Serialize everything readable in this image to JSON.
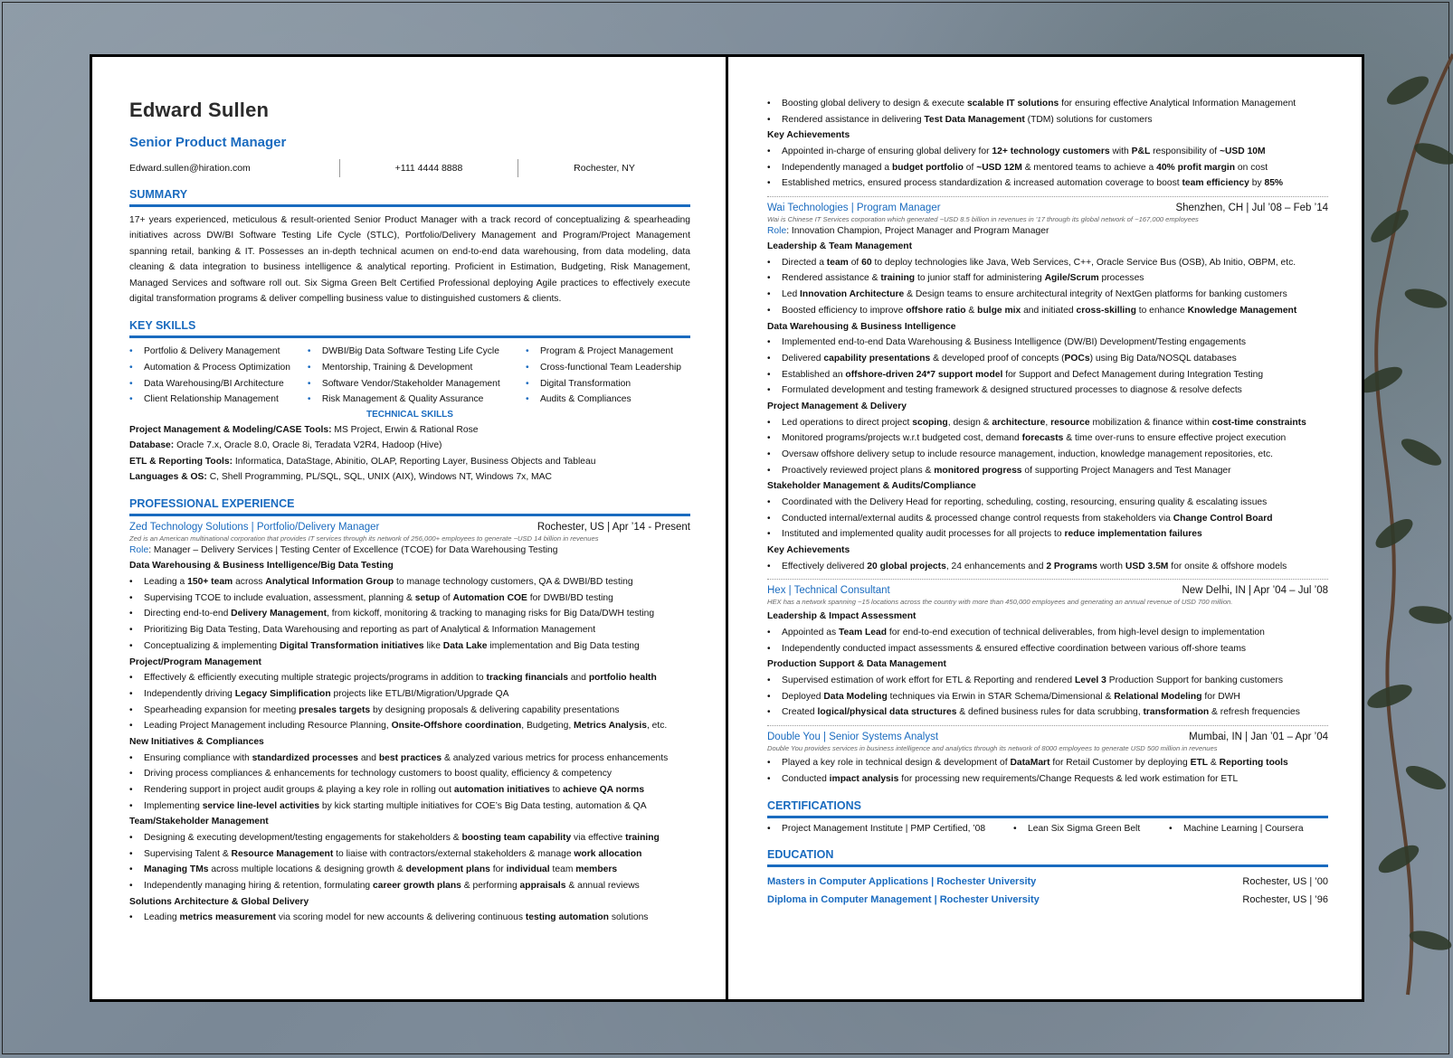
{
  "resume": {
    "name": "Edward Sullen",
    "title": "Senior Product Manager",
    "contact": {
      "email": "Edward.sullen@hiration.com",
      "phone": "+111 4444 8888",
      "location": "Rochester, NY"
    },
    "summary": {
      "heading": "SUMMARY",
      "text": "17+ years experienced, meticulous & result-oriented Senior Product Manager with a track record of conceptualizing & spearheading initiatives across DW/BI Software Testing Life Cycle (STLC), Portfolio/Delivery Management and Program/Project Management spanning retail, banking & IT. Possesses an in-depth technical acumen on end-to-end data warehousing, from data modeling, data cleaning & data integration to business intelligence & analytical reporting. Proficient in Estimation, Budgeting, Risk Management, Managed Services and software roll out. Six Sigma Green Belt Certified Professional deploying Agile practices to effectively execute digital transformation programs & deliver compelling business value to distinguished customers & clients."
    },
    "key_skills": {
      "heading": "KEY SKILLS",
      "col1": [
        "Portfolio & Delivery Management",
        "Automation & Process Optimization",
        "Data Warehousing/BI Architecture",
        "Client Relationship Management"
      ],
      "col2": [
        "DWBI/Big Data Software Testing Life Cycle",
        "Mentorship, Training & Development",
        "Software Vendor/Stakeholder Management",
        "Risk Management & Quality Assurance"
      ],
      "col3": [
        "Program & Project Management",
        "Cross-functional Team Leadership",
        "Digital Transformation",
        "Audits & Compliances"
      ]
    },
    "technical_skills": {
      "heading": "TECHNICAL SKILLS",
      "lines": [
        {
          "label": "Project Management & Modeling/CASE Tools:",
          "value": " MS Project, Erwin & Rational Rose"
        },
        {
          "label": "Database:",
          "value": " Oracle 7.x, Oracle 8.0, Oracle 8i, Teradata V2R4, Hadoop (Hive)"
        },
        {
          "label": "ETL & Reporting Tools:",
          "value": " Informatica, DataStage, Abinitio, OLAP, Reporting Layer, Business Objects and Tableau"
        },
        {
          "label": "Languages & OS:",
          "value": " C, Shell Programming, PL/SQL, SQL, UNIX (AIX), Windows NT, Windows 7x, MAC"
        }
      ]
    },
    "experience": {
      "heading": "PROFESSIONAL EXPERIENCE",
      "zed": {
        "company": "Zed Technology Solutions | Portfolio/Delivery Manager",
        "meta": "Rochester, US | Apr ’14 - Present",
        "desc": "Zed is an American multinational corporation that provides IT services through its network of 256,000+ employees to generate ~USD 14 billion in revenues",
        "role_label": "Role",
        "role": ": Manager – Delivery Services | Testing Center of Excellence (TCOE) for Data Warehousing Testing",
        "groups": [
          {
            "title": "Data Warehousing & Business Intelligence/Big Data Testing",
            "bullets": [
              "Leading a <b>150+ team</b> across <b>Analytical Information Group</b> to manage technology customers, QA & DWBI/BD testing",
              "Supervising TCOE to include evaluation, assessment, planning & <b>setup</b> of <b>Automation COE</b> for DWBI/BD testing",
              "Directing end-to-end <b>Delivery Management</b>, from kickoff, monitoring & tracking to managing risks for Big Data/DWH testing",
              "Prioritizing Big Data Testing, Data Warehousing and reporting as part of Analytical & Information Management",
              "Conceptualizing & implementing <b>Digital Transformation initiatives</b> like <b>Data Lake</b> implementation and Big Data testing"
            ]
          },
          {
            "title": "Project/Program Management",
            "bullets": [
              "Effectively & efficiently executing multiple strategic projects/programs in addition to <b>tracking financials</b> and <b>portfolio health</b>",
              "Independently driving <b>Legacy Simplification</b> projects like ETL/BI/Migration/Upgrade QA",
              "Spearheading expansion for meeting <b>presales targets</b> by designing proposals & delivering capability presentations",
              "Leading Project Management including Resource Planning, <b>Onsite-Offshore coordination</b>, Budgeting, <b>Metrics Analysis</b>, etc."
            ]
          },
          {
            "title": "New Initiatives & Compliances",
            "bullets": [
              "Ensuring compliance with <b>standardized processes</b> and <b>best practices</b> & analyzed various metrics for process enhancements",
              "Driving process compliances & enhancements for technology customers to boost quality, efficiency & competency",
              "Rendering support in project audit groups & playing a key role in rolling out <b>automation initiatives</b> to <b>achieve QA norms</b>",
              "Implementing <b>service line-level activities</b> by kick starting multiple initiatives for COE’s Big Data testing, automation & QA"
            ]
          },
          {
            "title": "Team/Stakeholder Management",
            "bullets": [
              "Designing & executing development/testing engagements for stakeholders & <b>boosting team capability</b> via effective <b>training</b>",
              "Supervising Talent & <b>Resource Management</b> to liaise with contractors/external stakeholders & manage <b>work allocation</b>",
              "<b>Managing TMs</b> across multiple locations & designing growth & <b>development plans</b> for <b>individual</b> team <b>members</b>",
              "Independently managing hiring & retention, formulating <b>career growth plans</b> & performing <b>appraisals</b> & annual reviews"
            ]
          },
          {
            "title": "Solutions Architecture & Global Delivery",
            "bullets": [
              "Leading <b>metrics measurement</b> via scoring model for new accounts & delivering continuous <b>testing automation</b> solutions"
            ]
          }
        ],
        "continued_bullets": [
          "Boosting global delivery to design & execute <b>scalable IT solutions</b> for ensuring effective Analytical Information Management",
          "Rendered assistance in delivering <b>Test Data Management</b> (TDM) solutions for customers"
        ],
        "achievements_title": "Key Achievements",
        "achievements": [
          "Appointed in-charge of ensuring global delivery for <b>12+ technology customers</b> with <b>P&L</b> responsibility of <b>~USD 10M</b>",
          "Independently managed a <b>budget portfolio</b> of <b>~USD 12M</b> & mentored teams to achieve a <b>40% profit margin</b> on cost",
          "Established metrics, ensured process standardization & increased automation coverage to boost <b>team efficiency</b> by <b>85%</b>"
        ]
      },
      "wai": {
        "company": "Wai Technologies | Program Manager",
        "meta": "Shenzhen, CH | Jul ’08 – Feb ’14",
        "desc": "Wai is Chinese IT Services corporation which generated ~USD 8.5 billion in revenues in ’17 through its global network of ~167,000 employees",
        "role_label": "Role",
        "role": ": Innovation Champion, Project Manager and Program Manager",
        "groups": [
          {
            "title": "Leadership & Team Management",
            "bullets": [
              "Directed a <b>team</b> of <b>60</b> to deploy technologies like Java, Web Services, C++, Oracle Service Bus (OSB), Ab Initio, OBPM, etc.",
              "Rendered assistance & <b>training</b> to junior staff for administering <b>Agile/Scrum</b> processes",
              "Led <b>Innovation Architecture</b> & Design teams to ensure architectural integrity of NextGen platforms for banking customers",
              "Boosted efficiency to improve <b>offshore ratio</b> & <b>bulge mix</b> and initiated <b>cross-skilling</b> to enhance <b>Knowledge Management</b>"
            ]
          },
          {
            "title": "Data Warehousing & Business Intelligence",
            "bullets": [
              "Implemented end-to-end Data Warehousing & Business Intelligence (DW/BI) Development/Testing engagements",
              "Delivered <b>capability presentations</b> & developed proof of concepts (<b>POCs</b>) using Big Data/NOSQL databases",
              "Established an <b>offshore-driven 24*7 support model</b> for Support and Defect Management during Integration Testing",
              "Formulated development and testing framework & designed structured processes to diagnose & resolve defects"
            ]
          },
          {
            "title": "Project Management & Delivery",
            "bullets": [
              "Led operations to direct project <b>scoping</b>, design & <b>architecture</b>, <b>resource</b> mobilization & finance within <b>cost-time constraints</b>",
              "Monitored programs/projects w.r.t budgeted cost, demand <b>forecasts</b> & time over-runs to ensure effective project execution",
              "Oversaw offshore delivery setup to include resource management, induction, knowledge management repositories, etc.",
              "Proactively reviewed project plans & <b>monitored progress</b> of supporting Project Managers and Test Manager"
            ]
          },
          {
            "title": "Stakeholder Management & Audits/Compliance",
            "bullets": [
              "Coordinated with the Delivery Head for reporting, scheduling, costing, resourcing, ensuring quality & escalating issues",
              "Conducted internal/external audits & processed change control requests from stakeholders via <b>Change Control Board</b>",
              "Instituted and implemented quality audit processes for all projects to <b>reduce implementation failures</b>"
            ]
          },
          {
            "title": "Key Achievements",
            "bullets": [
              "Effectively delivered <b>20 global projects</b>, 24 enhancements and <b>2 Programs</b> worth <b>USD 3.5M</b> for onsite & offshore models"
            ]
          }
        ]
      },
      "hex": {
        "company": "Hex | Technical Consultant",
        "meta": "New Delhi, IN | Apr ’04 – Jul ’08",
        "desc": "HEX has a network spanning ~15 locations across the country with more than 450,000 employees and generating an annual revenue of USD 700 million.",
        "groups": [
          {
            "title": "Leadership & Impact Assessment",
            "bullets": [
              "Appointed as <b>Team Lead</b> for end-to-end execution of technical deliverables, from high-level design to implementation",
              "Independently conducted impact assessments & ensured effective coordination between various off-shore teams"
            ]
          },
          {
            "title": "Production Support & Data Management",
            "bullets": [
              "Supervised estimation of work effort for ETL & Reporting and rendered <b>Level 3</b> Production Support for banking customers",
              "Deployed <b>Data Modeling</b> techniques via Erwin in STAR Schema/Dimensional & <b>Relational Modeling</b> for DWH",
              "Created <b>logical/physical data structures</b> & defined business rules for data scrubbing, <b>transformation</b> & refresh frequencies"
            ]
          }
        ]
      },
      "dy": {
        "company": "Double You | Senior Systems Analyst",
        "meta": "Mumbai, IN | Jan ’01 – Apr ’04",
        "desc": "Double You provides services in business intelligence and analytics through its network of 8000 employees to generate USD 500 million in revenues",
        "bullets": [
          "Played a key role in technical design & development of <b>DataMart</b> for Retail Customer by deploying <b>ETL</b> & <b>Reporting tools</b>",
          "Conducted <b>impact analysis</b> for processing new requirements/Change Requests & led work estimation for ETL"
        ]
      }
    },
    "certifications": {
      "heading": "CERTIFICATIONS",
      "items": [
        "Project Management Institute | PMP Certified, ’08",
        "Lean Six Sigma Green Belt",
        "Machine Learning | Coursera"
      ]
    },
    "education": {
      "heading": "EDUCATION",
      "items": [
        {
          "degree": "Masters in Computer Applications | Rochester University",
          "meta": "Rochester, US | ’00"
        },
        {
          "degree": "Diploma in Computer Management | Rochester University",
          "meta": "Rochester, US | ’96"
        }
      ]
    }
  },
  "colors": {
    "accent": "#1a6bbf",
    "text": "#111111",
    "page": "#ffffff"
  }
}
